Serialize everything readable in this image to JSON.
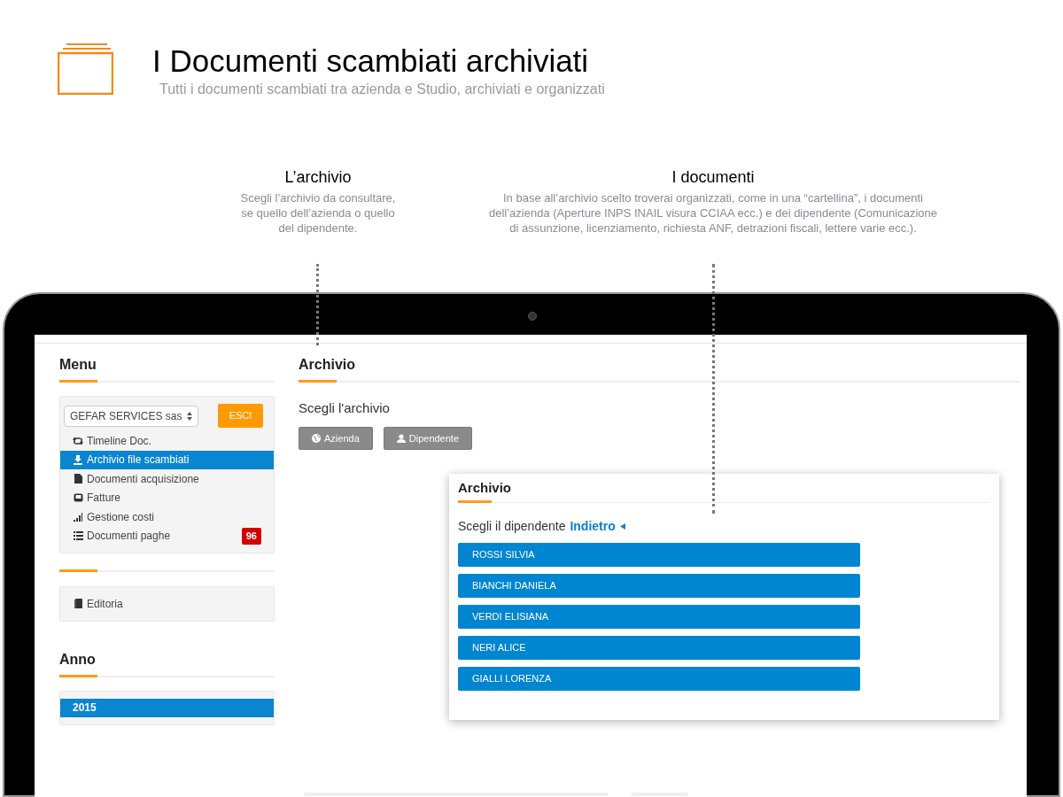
{
  "header": {
    "title": "I Documenti scambiati archiviati",
    "subtitle": "Tutti i documenti scambiati tra azienda e Studio, archiviati e organizzati"
  },
  "callouts": [
    {
      "title": "L’archivio",
      "text": "Scegli l’archivio da consultare, se quello dell’azienda o quello del dipendente."
    },
    {
      "title": "I documenti",
      "text": "In base all’archivio scelto troverai organizzati, come in una “cartellina”, i documenti dell’azienda (Aperture INPS INAIL visura CCIAA ecc.) e dei dipendente (Comunicazione di assunzione, licenziamento, richiesta ANF, detrazioni fiscali, lettere varie ecc.)."
    }
  ],
  "app": {
    "menu": {
      "title": "Menu",
      "company_select": "GEFAR SERVICES sas",
      "logout_button": "ESCI",
      "items": [
        {
          "label": "Timeline Doc.",
          "selected": false
        },
        {
          "label": "Archivio file scambiati",
          "selected": true
        },
        {
          "label": "Documenti acquisizione",
          "selected": false
        },
        {
          "label": "Fatture",
          "selected": false
        },
        {
          "label": "Gestione costi",
          "selected": false
        },
        {
          "label": "Documenti paghe",
          "selected": false,
          "badge": "96"
        }
      ],
      "extra_items": [
        {
          "label": "Editoria",
          "selected": false
        }
      ]
    },
    "year": {
      "title": "Anno",
      "items": [
        {
          "label": "2015",
          "selected": true
        }
      ]
    },
    "archive": {
      "title": "Archivio",
      "prompt": "Scegli l'archivio",
      "buttons": [
        "Azienda",
        "Dipendente"
      ]
    },
    "popup": {
      "title": "Archivio",
      "prompt": "Scegli il dipendente",
      "back_link": "Indietro",
      "employees": [
        "ROSSI SILVIA",
        "BIANCHI DANIELA",
        "VERDI ELISIANA",
        "NERI ALICE",
        "GIALLI LORENZA"
      ]
    }
  }
}
